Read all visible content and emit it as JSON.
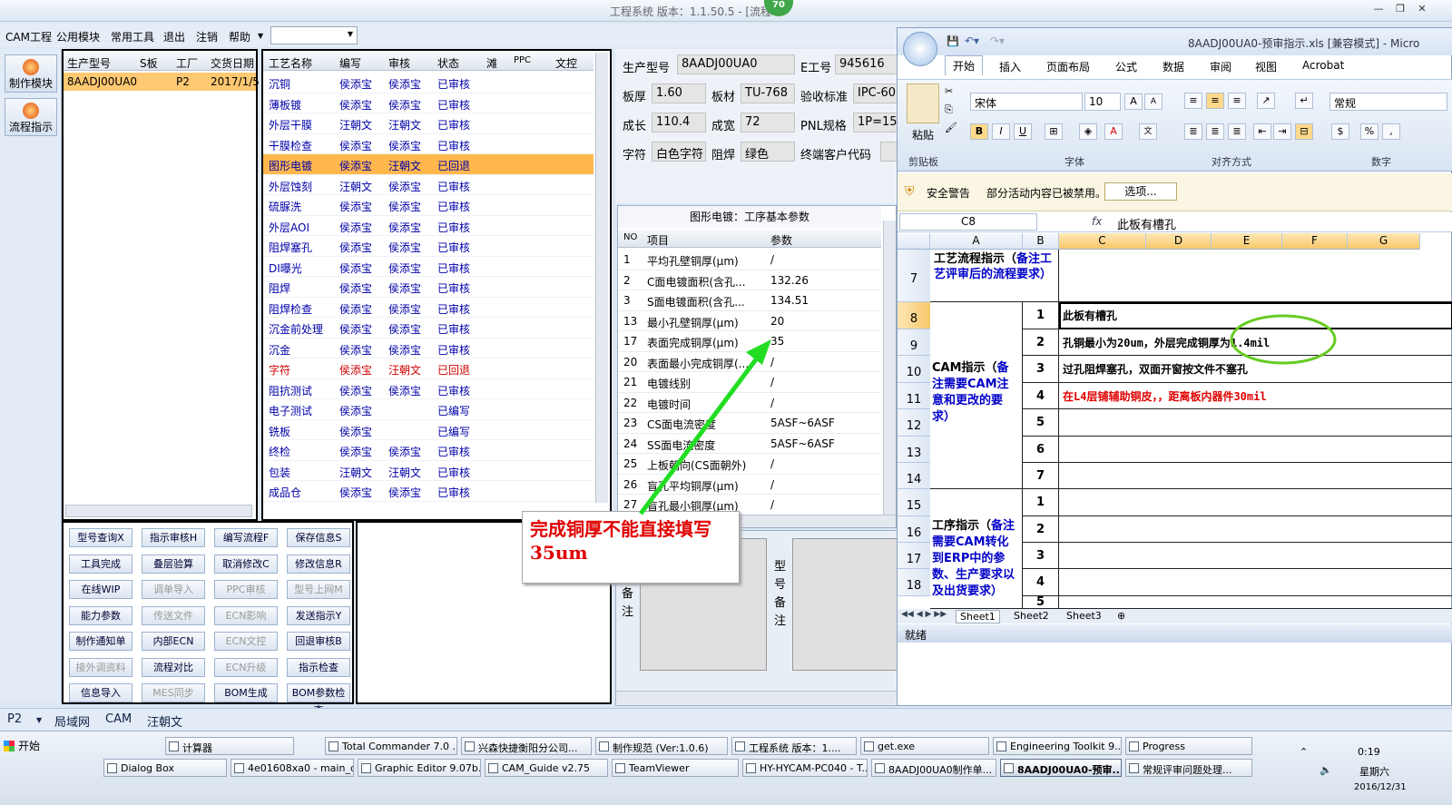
{
  "app": {
    "title": "工程系统  版本：1.1.50.5 - [流程",
    "badge": "70"
  },
  "menu": [
    "CAM工程",
    "公用模块",
    "常用工具",
    "退出",
    "注销",
    "帮助"
  ],
  "nav": [
    "制作模块",
    "流程指示"
  ],
  "order_grid": {
    "headers": [
      "生产型号",
      "S板",
      "工厂",
      "交货日期"
    ],
    "row": [
      "8AADJ00UA0",
      "",
      "P2",
      "2017/1/5"
    ]
  },
  "process_grid": {
    "headers": [
      "工艺名称",
      "编写",
      "审核",
      "状态",
      "滩",
      "PPC",
      "文控"
    ],
    "rows": [
      [
        "沉铜",
        "侯添宝",
        "侯添宝",
        "已审核"
      ],
      [
        "薄板镀",
        "侯添宝",
        "侯添宝",
        "已审核"
      ],
      [
        "外层干膜",
        "汪朝文",
        "汪朝文",
        "已审核"
      ],
      [
        "干膜检查",
        "侯添宝",
        "侯添宝",
        "已审核"
      ],
      [
        "图形电镀",
        "侯添宝",
        "汪朝文",
        "已回退"
      ],
      [
        "外层蚀刻",
        "汪朝文",
        "侯添宝",
        "已审核"
      ],
      [
        "硫脲洗",
        "侯添宝",
        "侯添宝",
        "已审核"
      ],
      [
        "外层AOI",
        "侯添宝",
        "侯添宝",
        "已审核"
      ],
      [
        "阻焊塞孔",
        "侯添宝",
        "侯添宝",
        "已审核"
      ],
      [
        "DI曝光",
        "侯添宝",
        "侯添宝",
        "已审核"
      ],
      [
        "阻焊",
        "侯添宝",
        "侯添宝",
        "已审核"
      ],
      [
        "阻焊检查",
        "侯添宝",
        "侯添宝",
        "已审核"
      ],
      [
        "沉金前处理",
        "侯添宝",
        "侯添宝",
        "已审核"
      ],
      [
        "沉金",
        "侯添宝",
        "侯添宝",
        "已审核"
      ],
      [
        "字符",
        "侯添宝",
        "汪朝文",
        "已回退"
      ],
      [
        "阻抗测试",
        "侯添宝",
        "侯添宝",
        "已审核"
      ],
      [
        "电子测试",
        "侯添宝",
        "",
        "已编写"
      ],
      [
        "铣板",
        "侯添宝",
        "",
        "已编写"
      ],
      [
        "终检",
        "侯添宝",
        "侯添宝",
        "已审核"
      ],
      [
        "包装",
        "汪朝文",
        "汪朝文",
        "已审核"
      ],
      [
        "成品仓",
        "侯添宝",
        "侯添宝",
        "已审核"
      ]
    ]
  },
  "func_buttons": [
    [
      "型号查询X",
      "指示审核H",
      "编写流程F",
      "保存信息S"
    ],
    [
      "工具完成",
      "叠层验算",
      "取消修改C",
      "修改信息R"
    ],
    [
      "在线WIP",
      "调单导入",
      "PPC审核",
      "型号上网M"
    ],
    [
      "能力参数",
      "传送文件",
      "ECN影响",
      "发送指示Y"
    ],
    [
      "制作通知单",
      "内部ECN",
      "ECN文控",
      "回退审核B"
    ],
    [
      "接外调资料",
      "流程对比",
      "ECN升级",
      "指示检查"
    ],
    [
      "信息导入",
      "MES同步",
      "BOM生成",
      "BOM参数检查"
    ]
  ],
  "info": {
    "l_model": "生产型号",
    "v_model": "8AADJ00UA0",
    "l_e": "E工号",
    "v_e": "945616",
    "l_thick": "板厚",
    "v_thick": "1.60",
    "l_mat": "板材",
    "v_mat": "TU-768",
    "l_std": "验收标准",
    "v_std": "IPC-60",
    "l_grow": "成长",
    "v_grow": "110.4",
    "l_fin": "成宽",
    "v_fin": "72",
    "l_pnl": "PNL规格",
    "v_pnl": "1P=15",
    "l_char": "字符",
    "v_char": "白色字符",
    "l_mask": "阻焊",
    "v_mask": "绿色",
    "l_cust": "终端客户代码"
  },
  "params": {
    "title": "图形电镀：工序基本参数",
    "h_no": "NO",
    "h_item": "项目",
    "h_val": "参数",
    "rows": [
      [
        "1",
        "平均孔壁铜厚(μm)",
        "/"
      ],
      [
        "2",
        "C面电镀面积(含孔...",
        "132.26"
      ],
      [
        "3",
        "S面电镀面积(含孔...",
        "134.51"
      ],
      [
        "13",
        "最小孔壁铜厚(μm)",
        "20"
      ],
      [
        "17",
        "表面完成铜厚(μm)",
        "35"
      ],
      [
        "20",
        "表面最小完成铜厚(...",
        "/"
      ],
      [
        "21",
        "电镀线别",
        "/"
      ],
      [
        "22",
        "电镀时间",
        "/"
      ],
      [
        "23",
        "CS面电流密度",
        "5ASF~6ASF"
      ],
      [
        "24",
        "SS面电流密度",
        "5ASF~6ASF"
      ],
      [
        "25",
        "上板朝向(CS面朝外)",
        "/"
      ],
      [
        "26",
        "盲孔平均铜厚(μm)",
        "/"
      ],
      [
        "27",
        "盲孔最小铜厚(μm)",
        "/"
      ]
    ]
  },
  "callout": "完成铜厚不能直接填写35um",
  "remarks": {
    "a": "艺备注",
    "b": "型号备注"
  },
  "excel": {
    "title": "8AADJ00UA0-预审指示.xls  [兼容模式] - Micro",
    "tabs": [
      "开始",
      "插入",
      "页面布局",
      "公式",
      "数据",
      "审阅",
      "视图",
      "Acrobat"
    ],
    "font": "宋体",
    "size": "10",
    "numfmt": "常规",
    "groups": [
      "剪贴板",
      "字体",
      "对齐方式",
      "数字"
    ],
    "paste": "粘贴",
    "security": "安全警告",
    "sec_msg": "部分活动内容已被禁用。",
    "options": "选项...",
    "namebox": "C8",
    "fx": "fx",
    "formula": "此板有槽孔",
    "cols": [
      "A",
      "B",
      "C",
      "D",
      "E",
      "F",
      "G"
    ],
    "rows": [
      "7",
      "8",
      "9",
      "10",
      "11",
      "12",
      "13",
      "14",
      "15",
      "16",
      "17",
      "18"
    ],
    "a7": "工艺流程指示（",
    "a7b": "备注工艺评审后的流程要求）",
    "a_cam": "CAM指示（",
    "a_camb": "备注需要CAM注意和更改的要求）",
    "a_proc": "工序指示（",
    "a_procb": "备注需要CAM转化到ERP中的参数、生产要求以及出货要求）",
    "nums": [
      "1",
      "2",
      "3",
      "4",
      "5",
      "6",
      "7",
      "1",
      "2",
      "3",
      "4",
      "5"
    ],
    "c8": "此板有槽孔",
    "c9": "孔铜最小为20um，外层完成铜厚为1.4mil",
    "c10": "过孔阻焊塞孔，双面开窗按文件不塞孔",
    "c11": "在L4层铺辅助铜皮，，距离板内器件30mil",
    "sheets": [
      "Sheet1",
      "Sheet2",
      "Sheet3"
    ],
    "status": "就绪"
  },
  "bottom_tabs": [
    "P2",
    "局域网",
    "CAM",
    "汪朝文"
  ],
  "taskbar": {
    "start": "开始",
    "row1": [
      "计算器",
      "Total Commander 7.0 ...",
      "兴森快捷衡阳分公司...",
      "制作规范 (Ver:1.0.6)",
      "工程系统  版本：1....",
      "get.exe",
      "Engineering Toolkit 9....",
      "Progress"
    ],
    "row2": [
      "Dialog Box",
      "4e01608xa0 - main_qa",
      "Graphic Editor 9.07b...",
      "CAM_Guide v2.75",
      "TeamViewer",
      "HY-HYCAM-PC040 - T...",
      "8AADJ00UA0制作单...",
      "8AADJ00UA0-预审...",
      "常规评审问题处理..."
    ],
    "time": "0:19",
    "day": "星期六",
    "date": "2016/12/31"
  },
  "colors": {
    "accent": "#ffb74d",
    "green_arrow": "#22dd22",
    "circle": "#66cc22"
  }
}
